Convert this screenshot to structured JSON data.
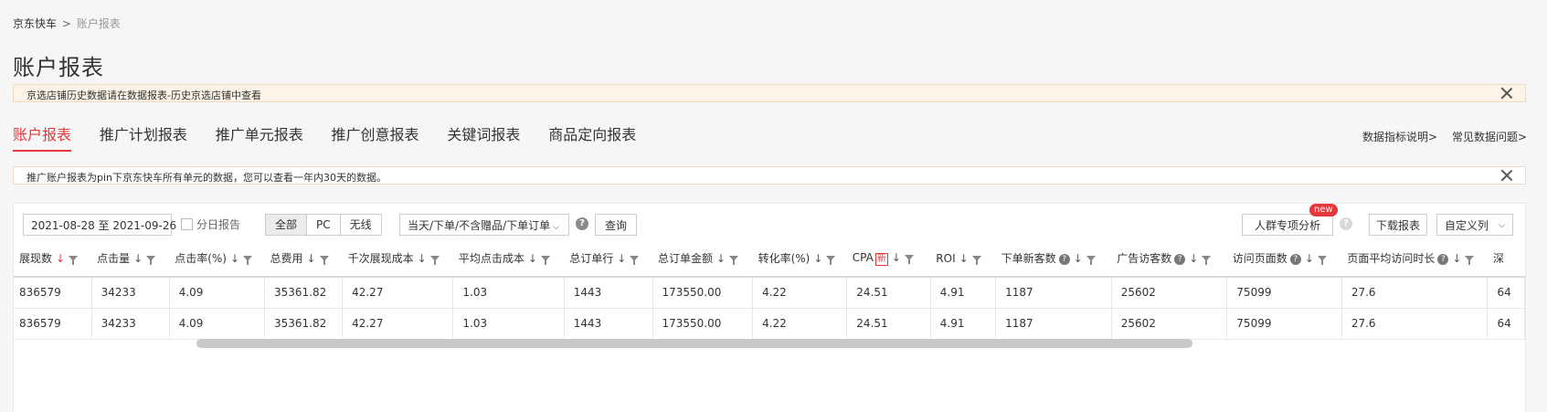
{
  "breadcrumb": {
    "root": "京东快车",
    "separator": ">",
    "current": "账户报表"
  },
  "page_title": "账户报表",
  "notices": [
    {
      "text": "京选店铺历史数据请在数据报表-历史京选店铺中查看"
    },
    {
      "text": "推广账户报表为pin下京东快车所有单元的数据，您可以查看一年内30天的数据。"
    }
  ],
  "tabs": [
    {
      "label": "账户报表",
      "active": true
    },
    {
      "label": "推广计划报表"
    },
    {
      "label": "推广单元报表"
    },
    {
      "label": "推广创意报表"
    },
    {
      "label": "关键词报表"
    },
    {
      "label": "商品定向报表"
    }
  ],
  "help_links": {
    "metrics": "数据指标说明>",
    "faq": "常见数据问题>"
  },
  "toolbar": {
    "date_range": "2021-08-28 至 2021-09-26",
    "daily_report": "分日报告",
    "segments": [
      "全部",
      "PC",
      "无线"
    ],
    "order_type": "当天/下单/不含赠品/下单订单",
    "query": "查询",
    "crowd_analysis": "人群专项分析",
    "new_badge": "new",
    "download": "下载报表",
    "custom_columns": "自定义列",
    "help_glyph": "?"
  },
  "table": {
    "columns": [
      "展现数",
      "点击量",
      "点击率(%)",
      "总费用",
      "千次展现成本",
      "平均点击成本",
      "总订单行",
      "总订单金额",
      "转化率(%)",
      "CPA",
      "ROI",
      "下单新客数",
      "广告访客数",
      "访问页面数",
      "页面平均访问时长",
      "深"
    ],
    "cpa_tag": "新",
    "sort_arrow": "↓",
    "rows": [
      [
        "836579",
        "34233",
        "4.09",
        "35361.82",
        "42.27",
        "1.03",
        "1443",
        "173550.00",
        "4.22",
        "24.51",
        "4.91",
        "1187",
        "25602",
        "75099",
        "27.6",
        "64"
      ],
      [
        "836579",
        "34233",
        "4.09",
        "35361.82",
        "42.27",
        "1.03",
        "1443",
        "173550.00",
        "4.22",
        "24.51",
        "4.91",
        "1187",
        "25602",
        "75099",
        "27.6",
        "64"
      ]
    ]
  },
  "colors": {
    "accent": "#e4393c",
    "notice_bg": "#fdf4e7"
  }
}
